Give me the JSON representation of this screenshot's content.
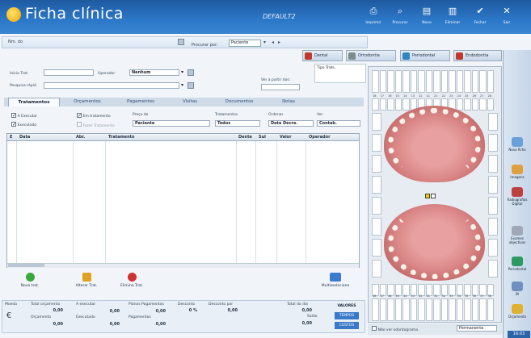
{
  "header": {
    "title": "Ficha clínica",
    "profile": "DEFAULT2",
    "buttons": [
      {
        "label": "Imprimir",
        "icon": "printer-icon"
      },
      {
        "label": "Procurar",
        "icon": "search-icon"
      },
      {
        "label": "Novo",
        "icon": "new-document-icon"
      },
      {
        "label": "Eliminar",
        "icon": "trash-icon"
      },
      {
        "label": "Fechar",
        "icon": "check-icon"
      },
      {
        "label": "Sair",
        "icon": "close-icon"
      }
    ]
  },
  "toolbar": {
    "favorites_label": "Nm. do",
    "search_label": "Procurar por:",
    "search_value": "Paciente"
  },
  "top_tabs": [
    {
      "label": "Dental",
      "color": "#c0392b"
    },
    {
      "label": "Ortodontia",
      "color": "#7f8c8d"
    },
    {
      "label": "Periodontal",
      "color": "#2e86c1"
    },
    {
      "label": "Endodontia",
      "color": "#c0392b"
    }
  ],
  "tipo_trat_label": "Tipo Trats.",
  "form": {
    "inicio_trat_label": "Inicio Trat.",
    "inicio_trat_value": "",
    "operador_label": "Operador",
    "operador_value": "Nenhum",
    "pesquisa_label": "Pesquisa rápid",
    "pesquisa_value": "",
    "ver_partir_label": "Ver a partir dos:"
  },
  "tabs": [
    "Tratamentos",
    "Orçamentos",
    "Pagamentos",
    "Visitas",
    "Documentos",
    "Notas"
  ],
  "filters": {
    "a_executar": "A Executar",
    "em_tratamento": "Em tratamento",
    "executado": "Executado",
    "fazer_tratamento": "Fazer Tratamento",
    "preco_label": "Preço de",
    "preco_value": "Paciente",
    "tratamentos_label": "Tratamentos",
    "tratamentos_value": "Todos",
    "ordenar_label": "Ordenar",
    "ordenar_value": "Data Decre.",
    "ver_label": "Ver",
    "ver_value": "Contab."
  },
  "grid": {
    "columns": [
      "E",
      "Data",
      "Abr.",
      "Tratamento",
      "Dente",
      "Sul",
      "Valor",
      "Operador"
    ]
  },
  "actions": [
    {
      "label": "Novo trat.",
      "color": "#3aa83a"
    },
    {
      "label": "Alterar Trat.",
      "color": "#e0a020"
    },
    {
      "label": "Elimina Trat.",
      "color": "#d03030"
    },
    {
      "label": "Multisselecione",
      "color": "#3d7bd0"
    }
  ],
  "totals": {
    "moeda_label": "Moeda",
    "total_orc_label": "Total orçamento",
    "total_orc_value": "0,00",
    "orcamento_label": "Orçamento",
    "orcamento_value": "0,00",
    "a_executar_label": "A executar",
    "a_executar_value": "0,00",
    "executado_label": "Executado",
    "executado_value": "0,00",
    "planos_label": "Planos Pagamentos",
    "planos_value": "0,00",
    "pagamentos_label": "Pagamentos",
    "pagamentos_value": "0,00",
    "desconto_label": "Desconto",
    "desconto_value": "0 %",
    "desconto_por_label": "Desconto por",
    "desconto_por_value": "0,00",
    "total_dia_label": "Total do dia",
    "total_dia_value": "0,00",
    "saldo_label": "Saldo",
    "saldo_value": "0,00",
    "valores_label": "VALORES",
    "tempos_label": "TEMPOS",
    "custos_label": "CUSTOS"
  },
  "odontogram": {
    "upper_numbers": [
      "18",
      "17",
      "16",
      "15",
      "14",
      "13",
      "12",
      "11",
      "21",
      "22",
      "23",
      "24",
      "25",
      "26",
      "27",
      "28"
    ],
    "lower_numbers": [
      "48",
      "47",
      "46",
      "45",
      "44",
      "43",
      "42",
      "41",
      "31",
      "32",
      "33",
      "34",
      "35",
      "36",
      "37",
      "38"
    ],
    "footer_check": "Não ver odontograma",
    "footer_select": "Permanente"
  },
  "sidebar": [
    {
      "label": "Nova ficha",
      "color": "#6aa0d8"
    },
    {
      "label": "Imagens",
      "color": "#e0a040"
    },
    {
      "label": "Radiografias Digital",
      "color": "#c04040"
    },
    {
      "label": "Exames objectivos",
      "color": "#a0a8b8"
    },
    {
      "label": "Periodontal",
      "color": "#2a9a60"
    },
    {
      "label": "Bl",
      "color": "#7090c0"
    },
    {
      "label": "Orçamento",
      "color": "#e0b030"
    }
  ],
  "status": {
    "time": "16:03"
  }
}
